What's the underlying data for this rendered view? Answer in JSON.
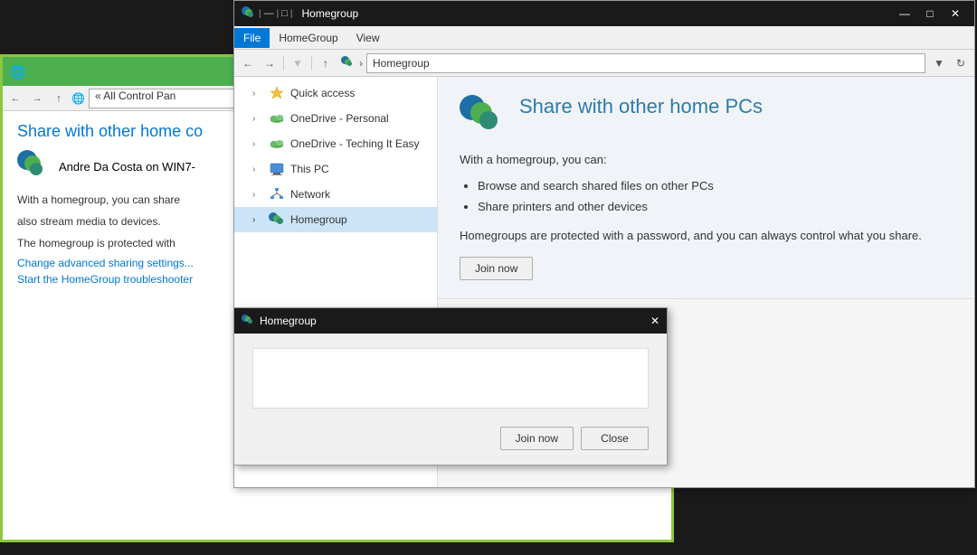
{
  "bg_window": {
    "nav_text": "« All Control Pan",
    "title": "Share with other home co",
    "homegroup_user": "Andre Da Costa on WIN7-",
    "desc1": "With a homegroup, you can share",
    "desc2": "also stream media to devices.",
    "desc3": "The homegroup is protected with",
    "link1": "Change advanced sharing settings...",
    "link2": "Start the HomeGroup troubleshooter"
  },
  "titlebar": {
    "title": "Homegroup",
    "minimize": "—",
    "maximize": "□",
    "close": "✕"
  },
  "menubar": {
    "items": [
      {
        "label": "File",
        "active": true
      },
      {
        "label": "HomeGroup",
        "active": false
      },
      {
        "label": "View",
        "active": false
      }
    ]
  },
  "navbar": {
    "back_tooltip": "Back",
    "forward_tooltip": "Forward",
    "up_tooltip": "Up",
    "address": "Homegroup",
    "refresh_tooltip": "Refresh"
  },
  "sidebar": {
    "items": [
      {
        "label": "Quick access",
        "icon": "star",
        "level": 1
      },
      {
        "label": "OneDrive - Personal",
        "icon": "cloud",
        "level": 1
      },
      {
        "label": "OneDrive - Teching It Easy",
        "icon": "cloud",
        "level": 1
      },
      {
        "label": "This PC",
        "icon": "computer",
        "level": 1
      },
      {
        "label": "Network",
        "icon": "network",
        "level": 1
      },
      {
        "label": "Homegroup",
        "icon": "homegroup",
        "level": 1,
        "active": true
      }
    ]
  },
  "share_panel": {
    "title": "Share with other home PCs",
    "subtitle": "With a homegroup, you can:",
    "bullets": [
      "Browse and search shared files on other PCs",
      "Share printers and other devices"
    ],
    "footer": "Homegroups are protected with a password, and you can always control what you share.",
    "join_btn": "Join now"
  },
  "dialog": {
    "join_btn": "Join now",
    "close_btn": "Close"
  }
}
